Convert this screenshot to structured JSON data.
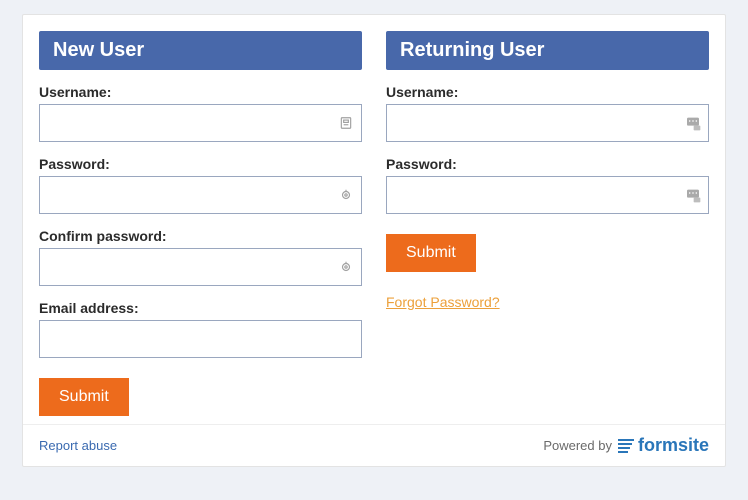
{
  "new_user": {
    "header": "New User",
    "username_label": "Username:",
    "password_label": "Password:",
    "confirm_label": "Confirm password:",
    "email_label": "Email address:",
    "submit_label": "Submit"
  },
  "returning_user": {
    "header": "Returning User",
    "username_label": "Username:",
    "password_label": "Password:",
    "submit_label": "Submit",
    "forgot_label": "Forgot Password?"
  },
  "footer": {
    "report_label": "Report abuse",
    "powered_label": "Powered by",
    "brand_name": "formsite"
  },
  "colors": {
    "header_bg": "#4868aa",
    "submit_bg": "#ed6b1c",
    "link": "#eca03a",
    "brand": "#2a76b9"
  }
}
